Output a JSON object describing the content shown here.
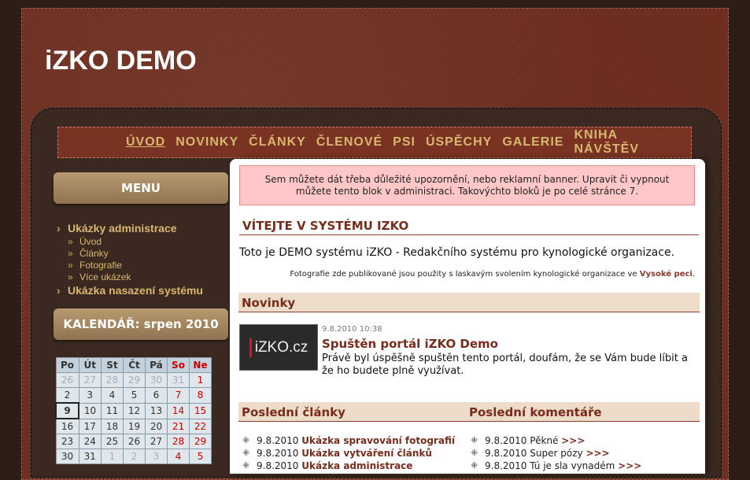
{
  "site": {
    "title": "iZKO DEMO"
  },
  "nav": [
    "ÚVOD",
    "NOVINKY",
    "ČLÁNKY",
    "ČLENOVÉ",
    "PSI",
    "ÚSPĚCHY",
    "GALERIE",
    "KNIHA NÁVŠTĚV"
  ],
  "menu": {
    "heading": "MENU",
    "items": [
      {
        "label": "Ukázky administrace",
        "children": [
          "Úvod",
          "Články",
          "Fotografie",
          "Více ukázek"
        ]
      },
      {
        "label": "Ukázka nasazení systému",
        "children": []
      }
    ]
  },
  "calendar": {
    "heading": "KALENDÁŘ: srpen 2010",
    "days": [
      "Po",
      "Út",
      "St",
      "Čt",
      "Pá",
      "So",
      "Ne"
    ],
    "weeks": [
      [
        "26",
        "27",
        "28",
        "29",
        "30",
        "31",
        "1"
      ],
      [
        "2",
        "3",
        "4",
        "5",
        "6",
        "7",
        "8"
      ],
      [
        "9",
        "10",
        "11",
        "12",
        "13",
        "14",
        "15"
      ],
      [
        "16",
        "17",
        "18",
        "19",
        "20",
        "21",
        "22"
      ],
      [
        "23",
        "24",
        "25",
        "26",
        "27",
        "28",
        "29"
      ],
      [
        "30",
        "31",
        "1",
        "2",
        "3",
        "4",
        "5"
      ]
    ]
  },
  "notice": "Sem můžete dát třeba důležité upozornění, nebo reklamní banner. Upravit či vypnout můžete tento blok v administraci. Takovýchto bloků je po celé stránce 7.",
  "welcome": {
    "title": "VÍTEJTE V SYSTÉMU IZKO",
    "intro": "Toto je DEMO systému iZKO - Redakčního systému pro kynologické organizace.",
    "credit": "Fotografie zde publikované jsou použity s laskavým svolením kynologické organizace ve",
    "credit_link": "Vysoké peci",
    "credit_end": "."
  },
  "news": {
    "heading": "Novinky",
    "thumb_text": "iZKO.cz",
    "date": "9.8.2010 10:38",
    "title": "Spuštěn portál iZKO Demo",
    "text": "Právě byl úspěšně spuštěn tento portál, doufám, že se Vám bude líbit a že ho budete plně využívat."
  },
  "articles": {
    "heading": "Poslední články",
    "items": [
      {
        "date": "9.8.2010",
        "title": "Ukázka spravování fotografií"
      },
      {
        "date": "9.8.2010",
        "title": "Ukázka vytváření článků"
      },
      {
        "date": "9.8.2010",
        "title": "Ukázka administrace"
      }
    ]
  },
  "comments": {
    "heading": "Poslední komentáře",
    "items": [
      {
        "date": "9.8.2010",
        "title": "Pěkné",
        "more": ">>>"
      },
      {
        "date": "9.8.2010",
        "title": "Super pózy",
        "more": ">>>"
      },
      {
        "date": "9.8.2010",
        "title": "Tú je sla vynadém",
        "more": ">>>"
      }
    ]
  }
}
